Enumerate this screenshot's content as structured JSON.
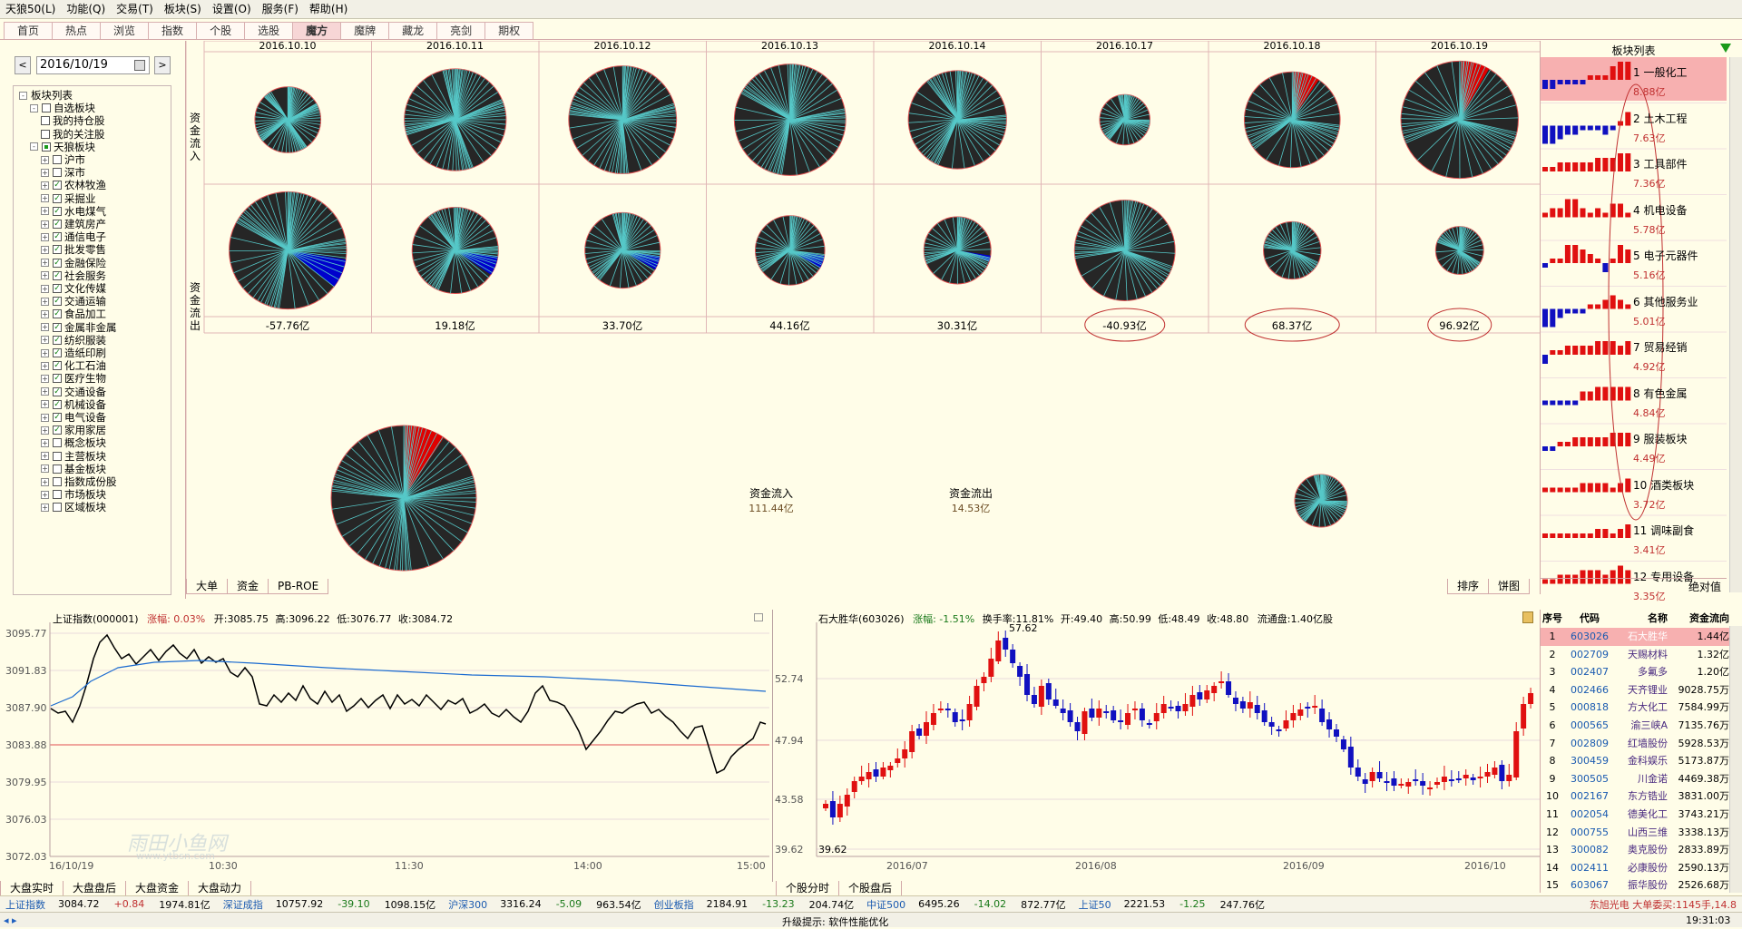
{
  "app": {
    "title": "天狼50(L)"
  },
  "menu": [
    "功能(Q)",
    "交易(T)",
    "板块(S)",
    "设置(O)",
    "服务(F)",
    "帮助(H)"
  ],
  "tabs": [
    "首页",
    "热点",
    "浏览",
    "指数",
    "个股",
    "选股",
    "魔方",
    "魔牌",
    "藏龙",
    "亮剑",
    "期权"
  ],
  "active_tab": "魔方",
  "date_picker": {
    "value": "2016/10/19",
    "prev": "<",
    "next": ">"
  },
  "tree": [
    {
      "label": "板块列表",
      "level": 0,
      "expand": "-",
      "check": null
    },
    {
      "label": "自选板块",
      "level": 1,
      "expand": "-",
      "check": "none"
    },
    {
      "label": "我的持仓股",
      "level": 2,
      "expand": null,
      "check": "none"
    },
    {
      "label": "我的关注股",
      "level": 2,
      "expand": null,
      "check": "none"
    },
    {
      "label": "天狼板块",
      "level": 1,
      "expand": "-",
      "check": "partial"
    },
    {
      "label": "沪市",
      "level": 2,
      "expand": "+",
      "check": "none"
    },
    {
      "label": "深市",
      "level": 2,
      "expand": "+",
      "check": "none"
    },
    {
      "label": "农林牧渔",
      "level": 2,
      "expand": "+",
      "check": "checked"
    },
    {
      "label": "采掘业",
      "level": 2,
      "expand": "+",
      "check": "checked"
    },
    {
      "label": "水电煤气",
      "level": 2,
      "expand": "+",
      "check": "checked"
    },
    {
      "label": "建筑房产",
      "level": 2,
      "expand": "+",
      "check": "checked"
    },
    {
      "label": "通信电子",
      "level": 2,
      "expand": "+",
      "check": "checked"
    },
    {
      "label": "批发零售",
      "level": 2,
      "expand": "+",
      "check": "checked"
    },
    {
      "label": "金融保险",
      "level": 2,
      "expand": "+",
      "check": "checked"
    },
    {
      "label": "社会服务",
      "level": 2,
      "expand": "+",
      "check": "checked"
    },
    {
      "label": "文化传媒",
      "level": 2,
      "expand": "+",
      "check": "checked"
    },
    {
      "label": "交通运输",
      "level": 2,
      "expand": "+",
      "check": "checked"
    },
    {
      "label": "食品加工",
      "level": 2,
      "expand": "+",
      "check": "checked"
    },
    {
      "label": "金属非金属",
      "level": 2,
      "expand": "+",
      "check": "checked"
    },
    {
      "label": "纺织服装",
      "level": 2,
      "expand": "+",
      "check": "checked"
    },
    {
      "label": "造纸印刷",
      "level": 2,
      "expand": "+",
      "check": "checked"
    },
    {
      "label": "化工石油",
      "level": 2,
      "expand": "+",
      "check": "checked"
    },
    {
      "label": "医疗生物",
      "level": 2,
      "expand": "+",
      "check": "checked"
    },
    {
      "label": "交通设备",
      "level": 2,
      "expand": "+",
      "check": "checked"
    },
    {
      "label": "机械设备",
      "level": 2,
      "expand": "+",
      "check": "checked"
    },
    {
      "label": "电气设备",
      "level": 2,
      "expand": "+",
      "check": "checked"
    },
    {
      "label": "家用家居",
      "level": 2,
      "expand": "+",
      "check": "checked"
    },
    {
      "label": "概念板块",
      "level": 2,
      "expand": "+",
      "check": "none"
    },
    {
      "label": "主营板块",
      "level": 2,
      "expand": "+",
      "check": "none"
    },
    {
      "label": "基金板块",
      "level": 2,
      "expand": "+",
      "check": "none"
    },
    {
      "label": "指数成份股",
      "level": 2,
      "expand": "+",
      "check": "none"
    },
    {
      "label": "市场板块",
      "level": 2,
      "expand": "+",
      "check": "none"
    },
    {
      "label": "区域板块",
      "level": 2,
      "expand": "+",
      "check": "none"
    }
  ],
  "cube": {
    "row_labels": [
      "资金流入",
      "资金流出"
    ],
    "dates": [
      "2016.10.10",
      "2016.10.11",
      "2016.10.12",
      "2016.10.13",
      "2016.10.14",
      "2016.10.17",
      "2016.10.18",
      "2016.10.19"
    ],
    "inflow_pie_scale": [
      0.55,
      0.85,
      0.9,
      0.93,
      0.82,
      0.42,
      0.8,
      0.98
    ],
    "inflow_highlight": [
      0,
      0,
      0,
      0,
      0,
      0,
      0.09,
      0.08
    ],
    "outflow_pie_scale": [
      0.98,
      0.72,
      0.63,
      0.58,
      0.56,
      0.84,
      0.48,
      0.4
    ],
    "outflow_highlight": [
      0.08,
      0.07,
      0.06,
      0.06,
      0.03,
      0,
      0,
      0
    ],
    "net_amounts": [
      "-57.76亿",
      "19.18亿",
      "33.70亿",
      "44.16亿",
      "30.31亿",
      "-40.93亿",
      "68.37亿",
      "96.92亿"
    ],
    "summary": {
      "in_label": "资金流入",
      "in_value": "111.44亿",
      "out_label": "资金流出",
      "out_value": "14.53亿"
    },
    "bottom_tabs": [
      "大单",
      "资金",
      "PB-ROE"
    ],
    "right_tabs": [
      "排序",
      "饼图"
    ]
  },
  "sector_list": {
    "title": "板块列表",
    "items": [
      {
        "label": "1 一般化工",
        "value": "8.88亿"
      },
      {
        "label": "2 土木工程",
        "value": "7.63亿"
      },
      {
        "label": "3 工具部件",
        "value": "7.36亿"
      },
      {
        "label": "4 机电设备",
        "value": "5.78亿"
      },
      {
        "label": "5 电子元器件",
        "value": "5.16亿"
      },
      {
        "label": "6 其他服务业",
        "value": "5.01亿"
      },
      {
        "label": "7 贸易经销",
        "value": "4.92亿"
      },
      {
        "label": "8 有色金属",
        "value": "4.84亿"
      },
      {
        "label": "9 服装板块",
        "value": "4.49亿"
      },
      {
        "label": "10 酒类板块",
        "value": "3.72亿"
      },
      {
        "label": "11 调味副食",
        "value": "3.41亿"
      },
      {
        "label": "12 专用设备",
        "value": "3.35亿"
      }
    ],
    "footer": "绝对值"
  },
  "index_chart": {
    "name": "上证指数(000001)",
    "change_label": "涨幅:",
    "change": "0.03%",
    "open_label": "开:",
    "open": "3085.75",
    "high_label": "高:",
    "high": "3096.22",
    "low_label": "低:",
    "low": "3076.77",
    "close_label": "收:",
    "close": "3084.72",
    "y_ticks": [
      "3095.77",
      "3091.83",
      "3087.90",
      "3083.88",
      "3079.95",
      "3076.03",
      "3072.03"
    ],
    "x_ticks": [
      "16/10/19",
      "10:30",
      "11:30",
      "14:00",
      "15:00"
    ],
    "watermark": "雨田小鱼网",
    "watermark_url": "www.ytbsn.com"
  },
  "stock_chart": {
    "name": "石大胜华(603026)",
    "change_label": "涨幅:",
    "change": "-1.51%",
    "turnover_label": "换手率:",
    "turnover": "11.81%",
    "open_label": "开:",
    "open": "49.40",
    "high_label": "高:",
    "high": "50.99",
    "low_label": "低:",
    "low": "48.49",
    "close_label": "收:",
    "close": "48.80",
    "float_label": "流通盘:",
    "float": "1.40亿股",
    "y_ticks": [
      "52.74",
      "47.94",
      "43.58",
      "39.62"
    ],
    "peak_label": "57.62",
    "low_mark": "39.62",
    "x_ticks": [
      "2016/07",
      "2016/08",
      "2016/09",
      "2016/10"
    ]
  },
  "stock_table": {
    "headers": [
      "序号",
      "代码",
      "名称",
      "资金流向"
    ],
    "rows": [
      [
        "1",
        "603026",
        "石大胜华",
        "1.44亿"
      ],
      [
        "2",
        "002709",
        "天赐材料",
        "1.32亿"
      ],
      [
        "3",
        "002407",
        "多氟多",
        "1.20亿"
      ],
      [
        "4",
        "002466",
        "天齐锂业",
        "9028.75万"
      ],
      [
        "5",
        "000818",
        "方大化工",
        "7584.99万"
      ],
      [
        "6",
        "000565",
        "渝三峡A",
        "7135.76万"
      ],
      [
        "7",
        "002809",
        "红墙股份",
        "5928.53万"
      ],
      [
        "8",
        "300459",
        "金科娱乐",
        "5173.87万"
      ],
      [
        "9",
        "300505",
        "川金诺",
        "4469.38万"
      ],
      [
        "10",
        "002167",
        "东方锆业",
        "3831.00万"
      ],
      [
        "11",
        "002054",
        "德美化工",
        "3743.21万"
      ],
      [
        "12",
        "000755",
        "山西三维",
        "3338.13万"
      ],
      [
        "13",
        "300082",
        "奥克股份",
        "2833.89万"
      ],
      [
        "14",
        "002411",
        "必康股份",
        "2590.13万"
      ],
      [
        "15",
        "603067",
        "振华股份",
        "2526.68万"
      ]
    ]
  },
  "bottom_tabs_left": [
    "大盘实时",
    "大盘盘后",
    "大盘资金",
    "大盘动力"
  ],
  "bottom_tabs_right": [
    "个股分时",
    "个股盘后"
  ],
  "ticker": [
    {
      "name": "上证指数",
      "v1": "3084.72",
      "v2": "+0.84",
      "v3": "1974.81亿"
    },
    {
      "name": "深证成指",
      "v1": "10757.92",
      "v2": "-39.10",
      "v3": "1098.15亿"
    },
    {
      "name": "沪深300",
      "v1": "3316.24",
      "v2": "-5.09",
      "v3": "963.54亿"
    },
    {
      "name": "创业板指",
      "v1": "2184.91",
      "v2": "-13.23",
      "v3": "204.74亿"
    },
    {
      "name": "中证500",
      "v1": "6495.26",
      "v2": "-14.02",
      "v3": "872.77亿"
    },
    {
      "name": "上证50",
      "v1": "2221.53",
      "v2": "-1.25",
      "v3": "247.76亿"
    }
  ],
  "ticker_news": "东旭光电  大单委买:1145手,14.8",
  "status": {
    "hint": "升级提示: 软件性能优化",
    "time": "19:31:03"
  },
  "colors": {
    "pie_bg": "#262626",
    "pie_line": "#56c8c8",
    "pie_rim": "#e05050",
    "inflow_hl": "#e00000",
    "outflow_hl": "#0000cc",
    "accent": "#c03030"
  }
}
